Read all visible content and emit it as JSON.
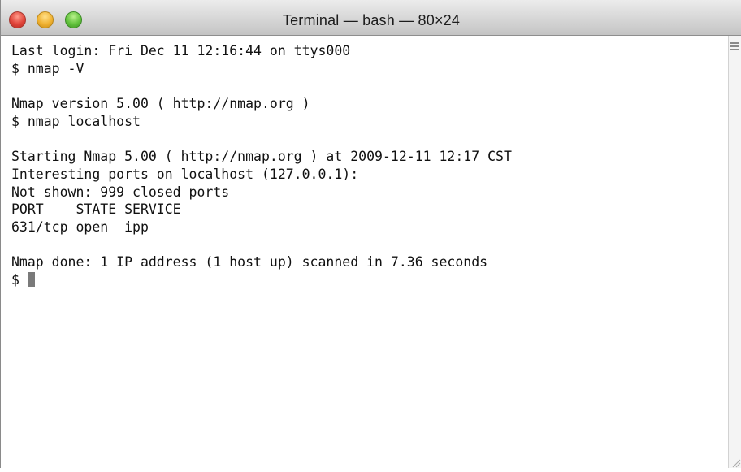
{
  "window": {
    "title": "Terminal — bash — 80×24"
  },
  "terminal": {
    "lines": [
      "Last login: Fri Dec 11 12:16:44 on ttys000",
      "$ nmap -V",
      "",
      "Nmap version 5.00 ( http://nmap.org )",
      "$ nmap localhost",
      "",
      "Starting Nmap 5.00 ( http://nmap.org ) at 2009-12-11 12:17 CST",
      "Interesting ports on localhost (127.0.0.1):",
      "Not shown: 999 closed ports",
      "PORT    STATE SERVICE",
      "631/tcp open  ipp",
      "",
      "Nmap done: 1 IP address (1 host up) scanned in 7.36 seconds"
    ],
    "prompt": "$ "
  },
  "colors": {
    "background": "#ffffff",
    "text": "#111111",
    "cursor": "#7a7a7a"
  }
}
